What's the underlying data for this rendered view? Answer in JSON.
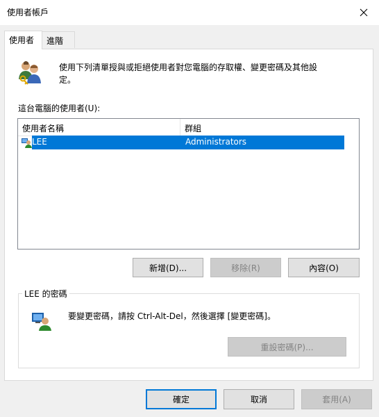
{
  "window": {
    "title": "使用者帳戶"
  },
  "tabs": [
    {
      "label": "使用者"
    },
    {
      "label": "進階"
    }
  ],
  "intro": {
    "line1": "使用下列清單授與或拒絕使用者對您電腦的存取權、變更密碼及其他設",
    "line2": "定。"
  },
  "users_label": "這台電腦的使用者(U):",
  "table": {
    "columns": [
      "使用者名稱",
      "群組"
    ],
    "rows": [
      {
        "name": "LEE",
        "group": "Administrators",
        "selected": true
      }
    ]
  },
  "buttons": {
    "add": "新增(D)...",
    "remove": "移除(R)",
    "properties": "內容(O)"
  },
  "password_group": {
    "title": "LEE 的密碼",
    "text": "要變更密碼，請按 Ctrl-Alt-Del，然後選擇 [變更密碼]。",
    "reset_button": "重設密碼(P)..."
  },
  "footer": {
    "ok": "確定",
    "cancel": "取消",
    "apply": "套用(A)"
  },
  "colors": {
    "selection": "#0078d7",
    "default_button_border": "#0078d7"
  }
}
